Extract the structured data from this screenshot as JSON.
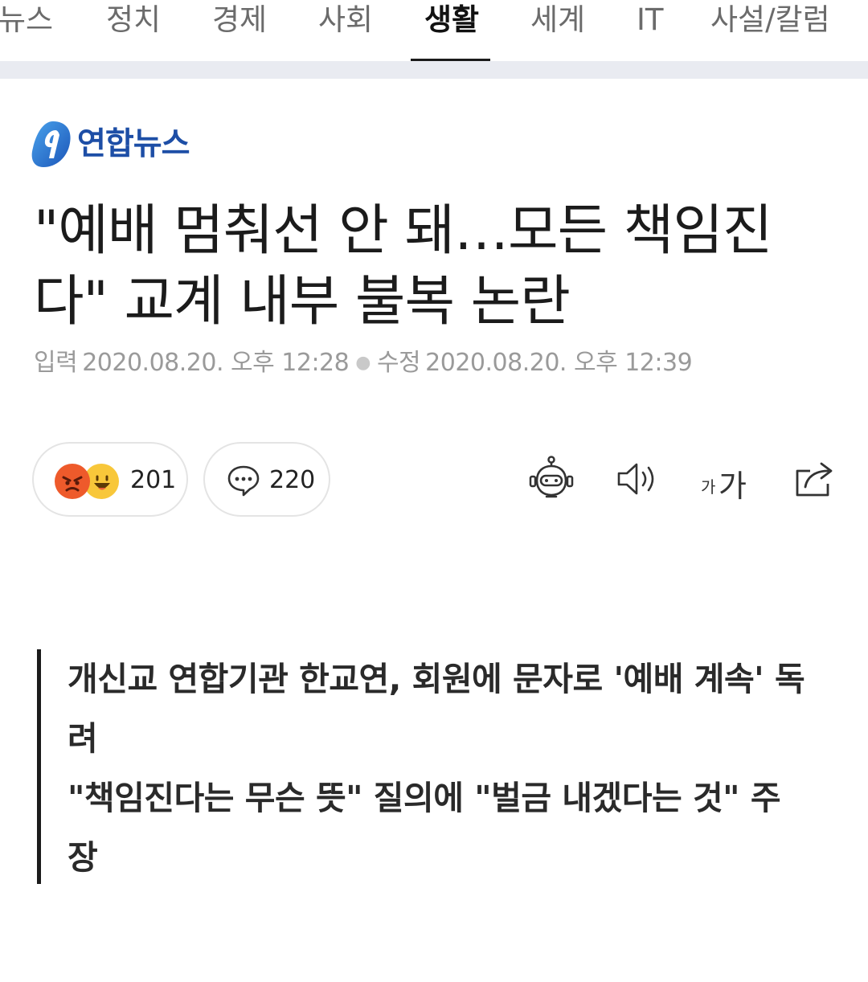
{
  "nav": {
    "items": [
      {
        "label": "뉴스",
        "active": false
      },
      {
        "label": "정치",
        "active": false
      },
      {
        "label": "경제",
        "active": false
      },
      {
        "label": "사회",
        "active": false
      },
      {
        "label": "생활",
        "active": true
      },
      {
        "label": "세계",
        "active": false
      },
      {
        "label": "IT",
        "active": false
      },
      {
        "label": "사설/칼럼",
        "active": false
      }
    ]
  },
  "press": {
    "name": "연합뉴스",
    "brand_color": "#1d4ea6"
  },
  "article": {
    "headline": "\"예배 멈춰선 안 돼…모든 책임진다\" 교계 내부 불복 논란",
    "input_label": "입력",
    "input_time": "2020.08.20. 오후 12:28",
    "edit_label": "수정",
    "edit_time": "2020.08.20. 오후 12:39"
  },
  "reactions": {
    "reaction_count": "201",
    "comment_count": "220",
    "emoji_icons": [
      "angry-emoji-icon",
      "laughing-emoji-icon"
    ]
  },
  "tools": {
    "summary_bot_icon": "robot-icon",
    "tts_icon": "speaker-icon",
    "font_small": "가",
    "font_big": "가",
    "share_icon": "share-icon"
  },
  "summary": {
    "lines": [
      "개신교 연합기관 한교연, 회원에 문자로 '예배 계속' 독려",
      "\"책임진다는 무슨 뜻\" 질의에 \"벌금 내겠다는 것\" 주장"
    ]
  }
}
